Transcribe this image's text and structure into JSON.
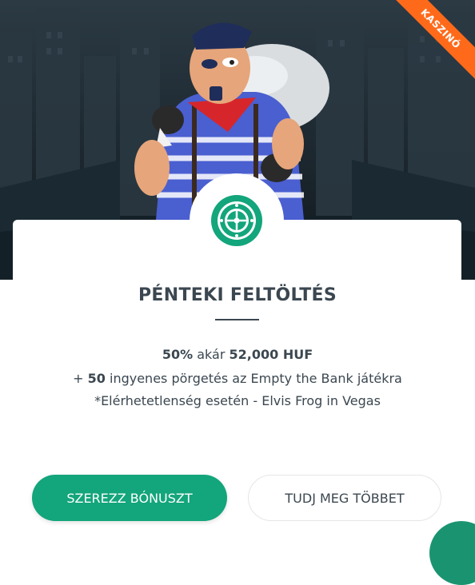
{
  "hero": {
    "illustration": "cartoon robber carrying a money sack in front of a city skyline",
    "ribbon_label": "KASZINÓ"
  },
  "badge": {
    "icon": "roulette-wheel-icon",
    "color": "#13a57b"
  },
  "promo": {
    "title": "PÉNTEKI FELTÖLTÉS",
    "percent": "50%",
    "upto_word": "akár",
    "amount": "52,000 HUF",
    "spins_prefix": "+",
    "spins_count": "50",
    "spins_text": "ingyenes pörgetés az Empty the Bank játékra",
    "fallback_note": "*Elérhetetlenség esetén - Elvis Frog in Vegas"
  },
  "actions": {
    "primary_label": "SZEREZZ BÓNUSZT",
    "secondary_label": "TUDJ MEG TÖBBET"
  },
  "colors": {
    "accent": "#13a57b",
    "ribbon": "#ff6a1a",
    "text": "#3b4750"
  }
}
